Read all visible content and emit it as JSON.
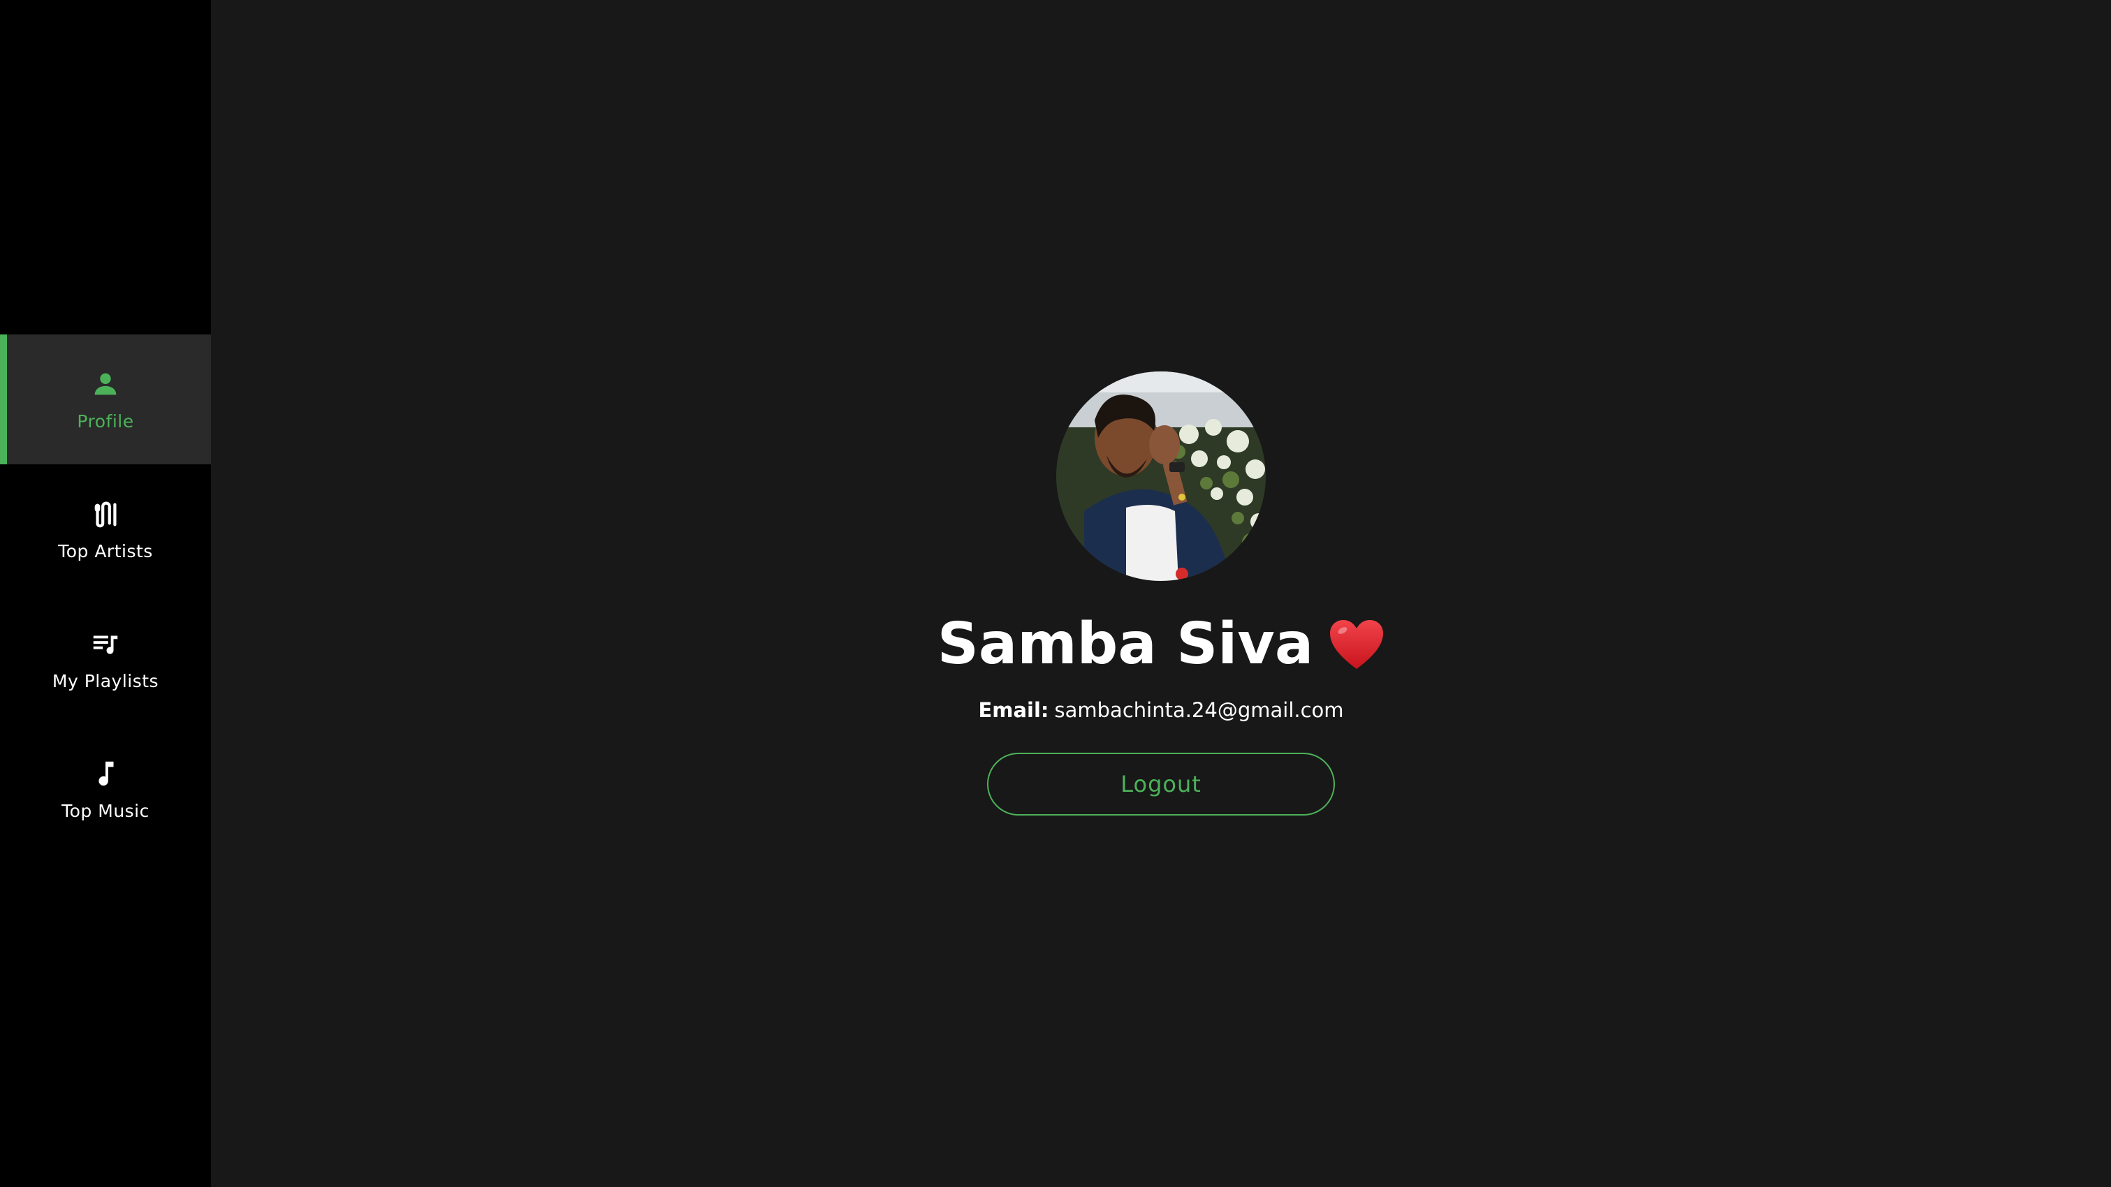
{
  "sidebar": {
    "items": [
      {
        "label": "Profile",
        "icon": "person-icon",
        "active": true
      },
      {
        "label": "Top Artists",
        "icon": "microphone-icon",
        "active": false
      },
      {
        "label": "My Playlists",
        "icon": "playlist-icon",
        "active": false
      },
      {
        "label": "Top Music",
        "icon": "music-note-icon",
        "active": false
      }
    ]
  },
  "profile": {
    "name": "Samba Siva",
    "name_emoji": "heart-icon",
    "email_label": "Email:",
    "email": "sambachinta.24@gmail.com",
    "logout_label": "Logout"
  },
  "colors": {
    "accent": "#4cb25a",
    "sidebar_bg": "#000000",
    "main_bg": "#181818",
    "active_item_bg": "#2a2a2a",
    "heart": "#e0232e"
  }
}
